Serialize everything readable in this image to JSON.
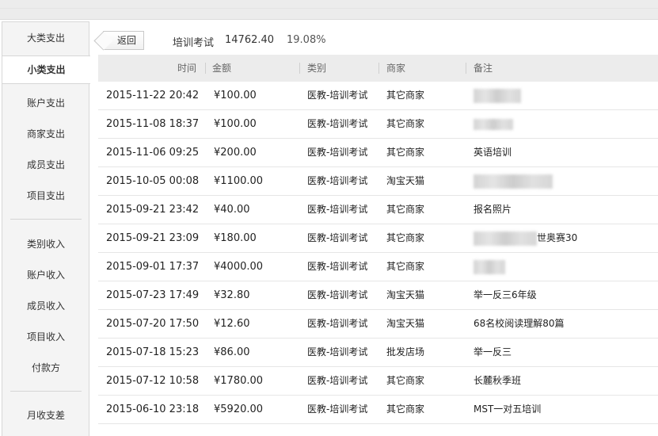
{
  "sidebar": {
    "items": [
      {
        "label": "大类支出",
        "active": false
      },
      {
        "label": "小类支出",
        "active": true
      },
      {
        "label": "账户支出",
        "active": false
      },
      {
        "label": "商家支出",
        "active": false
      },
      {
        "label": "成员支出",
        "active": false
      },
      {
        "label": "项目支出",
        "active": false
      },
      {
        "label": "类别收入",
        "active": false
      },
      {
        "label": "账户收入",
        "active": false
      },
      {
        "label": "成员收入",
        "active": false
      },
      {
        "label": "项目收入",
        "active": false
      },
      {
        "label": "付款方",
        "active": false
      },
      {
        "label": "月收支差",
        "active": false
      }
    ]
  },
  "header": {
    "back_label": "返回",
    "category": "培训考试",
    "amount": "14762.40",
    "percent": "19.08%"
  },
  "table": {
    "columns": [
      "时间",
      "金额",
      "类别",
      "商家",
      "备注"
    ],
    "rows": [
      {
        "time": "2015-11-22 20:42",
        "amount": "¥100.00",
        "category": "医教-培训考试",
        "merchant": "其它商家",
        "note": ""
      },
      {
        "time": "2015-11-08 18:37",
        "amount": "¥100.00",
        "category": "医教-培训考试",
        "merchant": "其它商家",
        "note": ""
      },
      {
        "time": "2015-11-06 09:25",
        "amount": "¥200.00",
        "category": "医教-培训考试",
        "merchant": "其它商家",
        "note": "英语培训"
      },
      {
        "time": "2015-10-05 00:08",
        "amount": "¥1100.00",
        "category": "医教-培训考试",
        "merchant": "淘宝天猫",
        "note": ""
      },
      {
        "time": "2015-09-21 23:42",
        "amount": "¥40.00",
        "category": "医教-培训考试",
        "merchant": "其它商家",
        "note": "报名照片"
      },
      {
        "time": "2015-09-21 23:09",
        "amount": "¥180.00",
        "category": "医教-培训考试",
        "merchant": "其它商家",
        "note": "世奥赛30"
      },
      {
        "time": "2015-09-01 17:37",
        "amount": "¥4000.00",
        "category": "医教-培训考试",
        "merchant": "其它商家",
        "note": ""
      },
      {
        "time": "2015-07-23 17:49",
        "amount": "¥32.80",
        "category": "医教-培训考试",
        "merchant": "淘宝天猫",
        "note": "举一反三6年级"
      },
      {
        "time": "2015-07-20 17:50",
        "amount": "¥12.60",
        "category": "医教-培训考试",
        "merchant": "淘宝天猫",
        "note": "68名校阅读理解80篇"
      },
      {
        "time": "2015-07-18 15:23",
        "amount": "¥86.00",
        "category": "医教-培训考试",
        "merchant": "批发店场",
        "note": "举一反三"
      },
      {
        "time": "2015-07-12 10:58",
        "amount": "¥1780.00",
        "category": "医教-培训考试",
        "merchant": "其它商家",
        "note": "长麓秋季班"
      },
      {
        "time": "2015-06-10 23:18",
        "amount": "¥5920.00",
        "category": "医教-培训考试",
        "merchant": "其它商家",
        "note": "MST一对五培训"
      }
    ]
  }
}
